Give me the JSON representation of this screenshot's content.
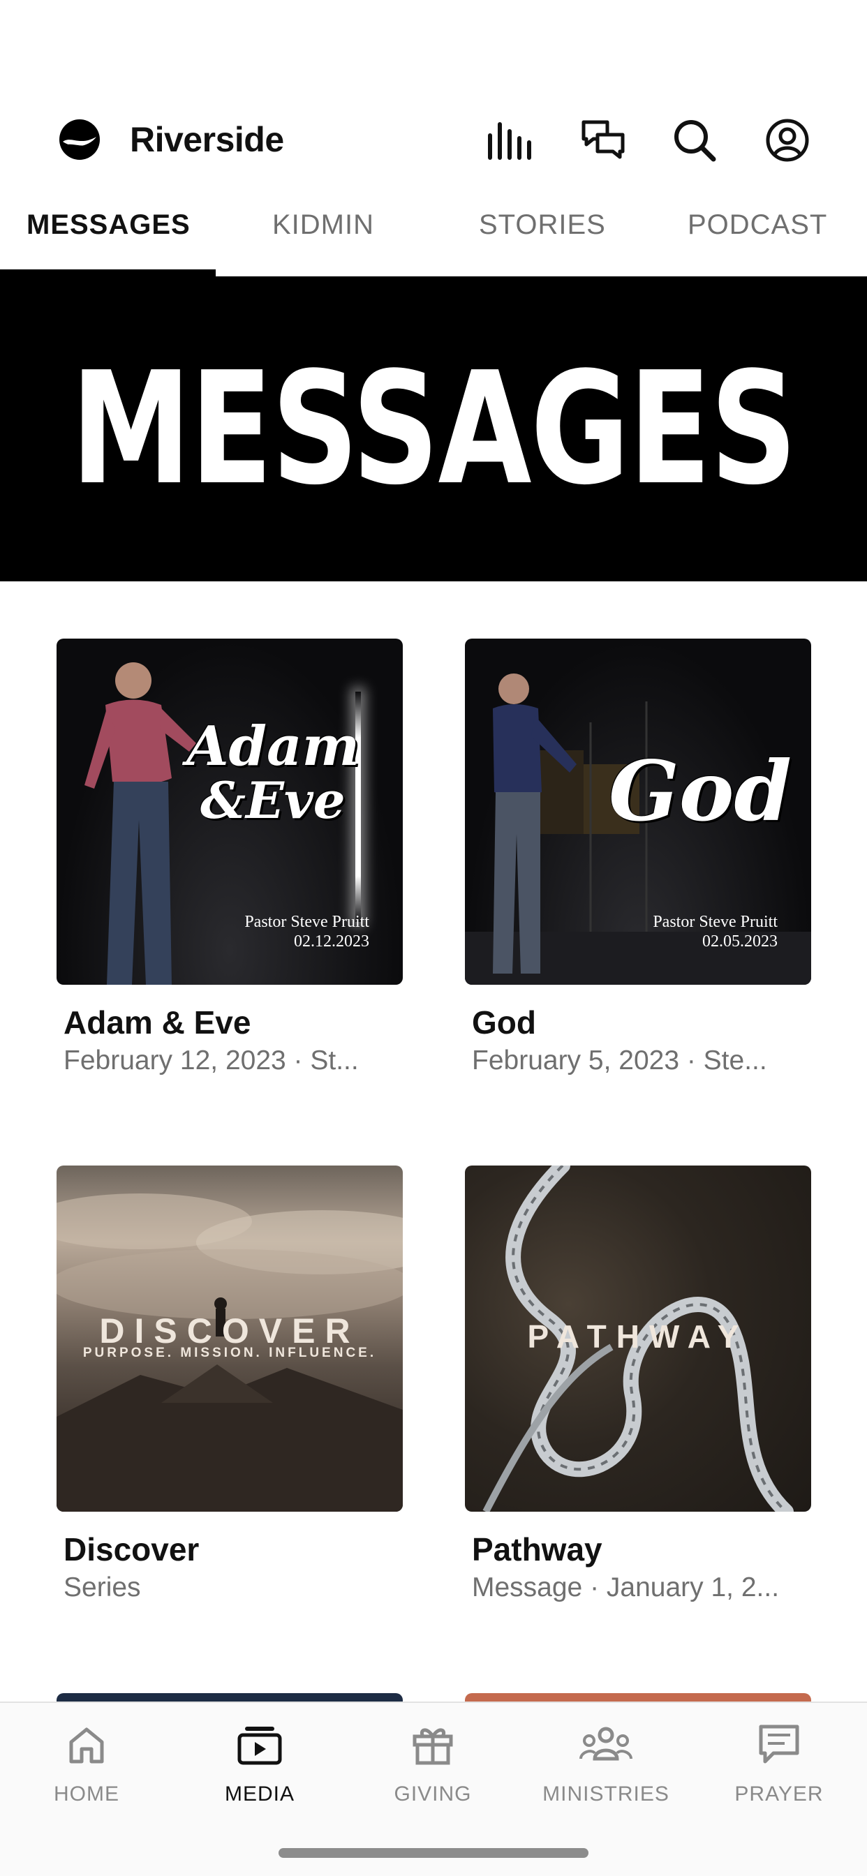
{
  "header": {
    "title": "Riverside",
    "icons": [
      "logo-icon",
      "audio-bars-icon",
      "chat-icon",
      "search-icon",
      "profile-icon"
    ]
  },
  "tabs": [
    {
      "label": "MESSAGES",
      "active": true
    },
    {
      "label": "KIDMIN",
      "active": false
    },
    {
      "label": "STORIES",
      "active": false
    },
    {
      "label": "PODCAST",
      "active": false
    }
  ],
  "banner": {
    "text": "MESSAGES"
  },
  "cards": [
    {
      "title": "Adam & Eve",
      "subtitle": "February 12, 2023 · St...",
      "thumb": {
        "script_line1": "Adam",
        "script_line2": "&Eve",
        "pastor": "Pastor Steve Pruitt",
        "date": "02.12.2023"
      }
    },
    {
      "title": "God",
      "subtitle": "February 5, 2023 · Ste...",
      "thumb": {
        "script_line1": "God",
        "pastor": "Pastor Steve Pruitt",
        "date": "02.05.2023"
      }
    },
    {
      "title": "Discover",
      "subtitle": "Series",
      "thumb": {
        "word": "DISCOVER",
        "tagline": "PURPOSE. MISSION. INFLUENCE."
      }
    },
    {
      "title": "Pathway",
      "subtitle": "Message · January 1, 2...",
      "thumb": {
        "word": "PATHWAY"
      }
    }
  ],
  "bottom_nav": [
    {
      "label": "HOME",
      "icon": "home-icon",
      "active": false
    },
    {
      "label": "MEDIA",
      "icon": "media-icon",
      "active": true
    },
    {
      "label": "GIVING",
      "icon": "gift-icon",
      "active": false
    },
    {
      "label": "MINISTRIES",
      "icon": "people-icon",
      "active": false
    },
    {
      "label": "PRAYER",
      "icon": "prayer-message-icon",
      "active": false
    }
  ],
  "colors": {
    "accent": "#000000",
    "inactive_text": "#6f6f6f",
    "nav_background": "#fafafa"
  }
}
